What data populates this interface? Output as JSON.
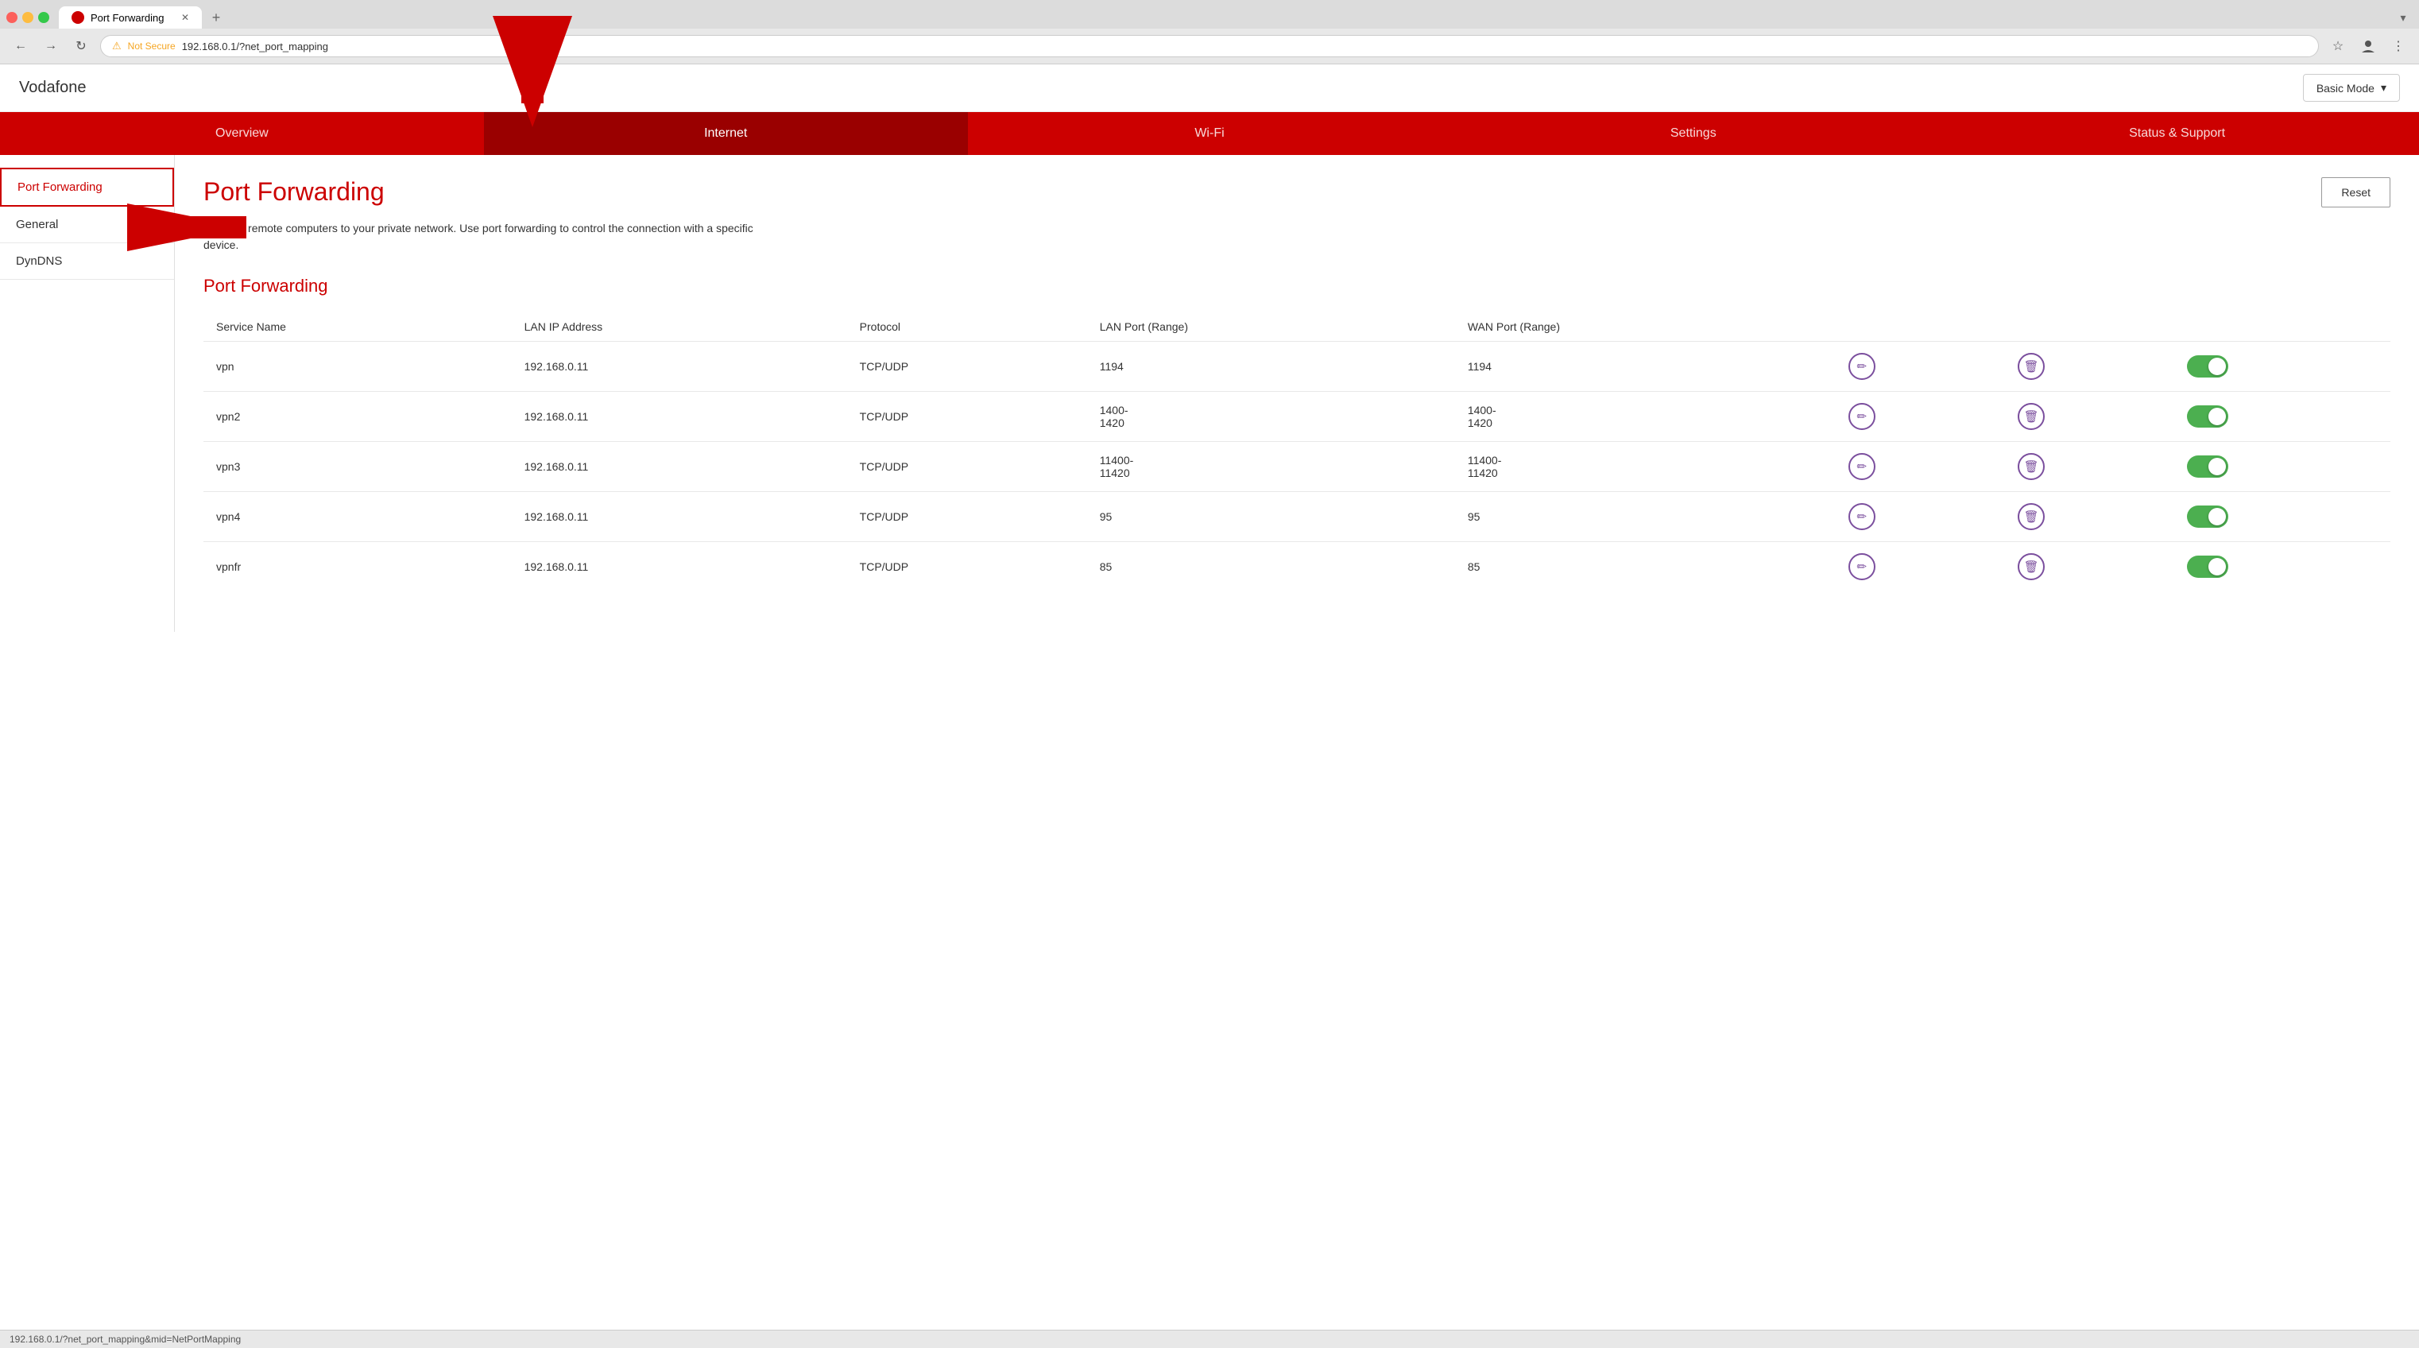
{
  "browser": {
    "tab_title": "Port Forwarding",
    "url": "192.168.0.1/?net_port_mapping",
    "not_secure_label": "Not Secure",
    "new_tab_symbol": "+",
    "mode_selector": "Basic Mode"
  },
  "router": {
    "brand": "Vodafone",
    "mode_label": "Basic Mode"
  },
  "nav": {
    "tabs": [
      {
        "id": "overview",
        "label": "Overview",
        "active": false
      },
      {
        "id": "internet",
        "label": "Internet",
        "active": true
      },
      {
        "id": "wifi",
        "label": "Wi-Fi",
        "active": false
      },
      {
        "id": "settings",
        "label": "Settings",
        "active": false
      },
      {
        "id": "status",
        "label": "Status & Support",
        "active": false
      }
    ]
  },
  "sidebar": {
    "items": [
      {
        "id": "port-forwarding",
        "label": "Port Forwarding",
        "active": true
      },
      {
        "id": "general",
        "label": "General",
        "active": false
      },
      {
        "id": "dyndns",
        "label": "DynDNS",
        "active": false
      }
    ]
  },
  "content": {
    "page_title": "Port Forwarding",
    "description": "Connect remote computers to your private network. Use port forwarding to control the connection with a specific device.",
    "reset_label": "Reset",
    "section_title": "Port Forwarding",
    "table": {
      "headers": [
        "Service Name",
        "LAN IP Address",
        "Protocol",
        "LAN Port (Range)",
        "WAN Port (Range)",
        "",
        "",
        ""
      ],
      "rows": [
        {
          "service": "vpn",
          "lan_ip": "192.168.0.11",
          "protocol": "TCP/UDP",
          "lan_port": "1194",
          "wan_port": "1194",
          "enabled": true
        },
        {
          "service": "vpn2",
          "lan_ip": "192.168.0.11",
          "protocol": "TCP/UDP",
          "lan_port": "1400-\n1420",
          "wan_port": "1400-\n1420",
          "enabled": true
        },
        {
          "service": "vpn3",
          "lan_ip": "192.168.0.11",
          "protocol": "TCP/UDP",
          "lan_port": "11400-\n11420",
          "wan_port": "11400-\n11420",
          "enabled": true
        },
        {
          "service": "vpn4",
          "lan_ip": "192.168.0.11",
          "protocol": "TCP/UDP",
          "lan_port": "95",
          "wan_port": "95",
          "enabled": true
        },
        {
          "service": "vpnfr",
          "lan_ip": "192.168.0.11",
          "protocol": "TCP/UDP",
          "lan_port": "85",
          "wan_port": "85",
          "enabled": true
        }
      ]
    }
  },
  "status_bar": {
    "url": "192.168.0.1/?net_port_mapping&mid=NetPortMapping"
  },
  "icons": {
    "edit": "✏",
    "delete": "🗑",
    "chevron_down": "▾",
    "back": "←",
    "forward": "→",
    "refresh": "↻",
    "lock_warning": "⚠",
    "star": "☆",
    "profile": "👤",
    "more_vert": "⋮",
    "more_horiz": "≡"
  }
}
